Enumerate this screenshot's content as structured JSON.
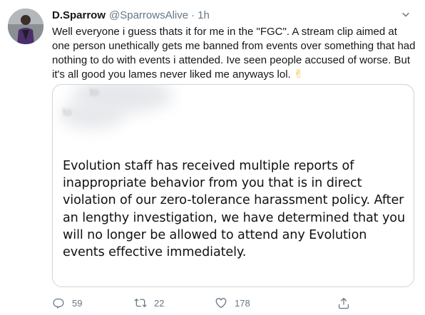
{
  "tweet": {
    "author_name": "D.Sparrow",
    "author_handle": "@SparrowsAlive",
    "separator": "·",
    "time": "1h",
    "body": "Well everyone i guess thats it for me in the \"FGC\". A stream clip aimed at one person unethically gets me banned from events over something that had nothing to do with events i attended. Ive seen people accused of worse. But it's all good you lames never liked me anyways lol.",
    "emoji": "✌",
    "card": {
      "blurred_top": "to",
      "blurred_left": "to",
      "notice": "Evolution staff has received multiple reports of inappropriate behavior from you that is in direct violation of our zero-tolerance harassment policy. After an lengthy investigation, we have determined that you will no longer be allowed to attend any Evolution events effective immediately."
    },
    "actions": {
      "replies": "59",
      "retweets": "22",
      "likes": "178"
    }
  },
  "icons": {
    "avatar": "profile-photo",
    "caret": "chevron-down-icon",
    "reply": "reply-icon",
    "retweet": "retweet-icon",
    "like": "heart-icon",
    "share": "share-icon"
  },
  "colors": {
    "text": "#14171a",
    "secondary": "#657786",
    "border": "#ccd6dd"
  }
}
